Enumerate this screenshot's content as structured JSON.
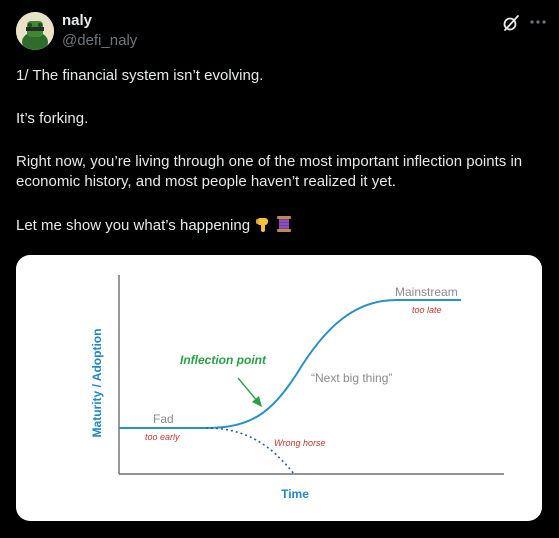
{
  "author": {
    "name": "naly",
    "handle": "@defi_naly"
  },
  "icons": {
    "avatar": "green-frog-avatar",
    "grok": "grok-icon",
    "more": "more-dots-icon",
    "emoji_1": "backhand-index-pointing-down",
    "emoji_2": "spool-of-thread"
  },
  "post": {
    "paragraphs": [
      "1/ The financial system isn’t evolving.",
      "It’s forking.",
      "Right now, you’re living through one of the most important inflection points in economic history, and most people haven’t realized it yet.",
      "Let me show you what’s happening"
    ]
  },
  "chart": {
    "x_axis_label": "Time",
    "y_axis_label": "Maturity / Adoption",
    "annotations": {
      "inflection": "Inflection point",
      "mainstream": "Mainstream",
      "too_late": "too late",
      "next_big_thing": "“Next big thing”",
      "fad": "Fad",
      "too_early": "too early",
      "wrong_horse": "Wrong horse"
    },
    "colors": {
      "curve": "#2a8fc7",
      "axis_label": "#1f87c6",
      "inflection": "#27a046",
      "red_note": "#c0392b",
      "grey_note": "#8a8a8a",
      "axis": "#555555"
    }
  }
}
